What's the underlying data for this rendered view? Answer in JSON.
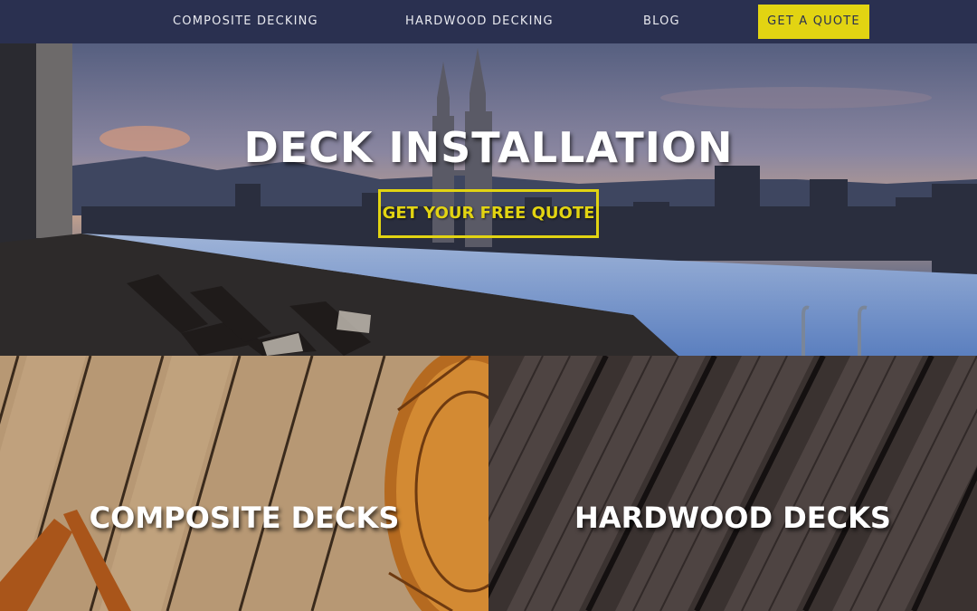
{
  "nav": {
    "links": [
      {
        "label": "COMPOSITE DECKING"
      },
      {
        "label": "HARDWOOD DECKING"
      },
      {
        "label": "BLOG"
      }
    ],
    "cta_label": "GET A QUOTE"
  },
  "hero": {
    "title": "DECK INSTALLATION",
    "cta_label": "GET YOUR FREE QUOTE"
  },
  "tiles": [
    {
      "title": "COMPOSITE DECKS"
    },
    {
      "title": "HARDWOOD DECKS"
    }
  ],
  "colors": {
    "nav_bg": "#2a3050",
    "accent": "#e2d412",
    "text_light": "#ffffff"
  }
}
